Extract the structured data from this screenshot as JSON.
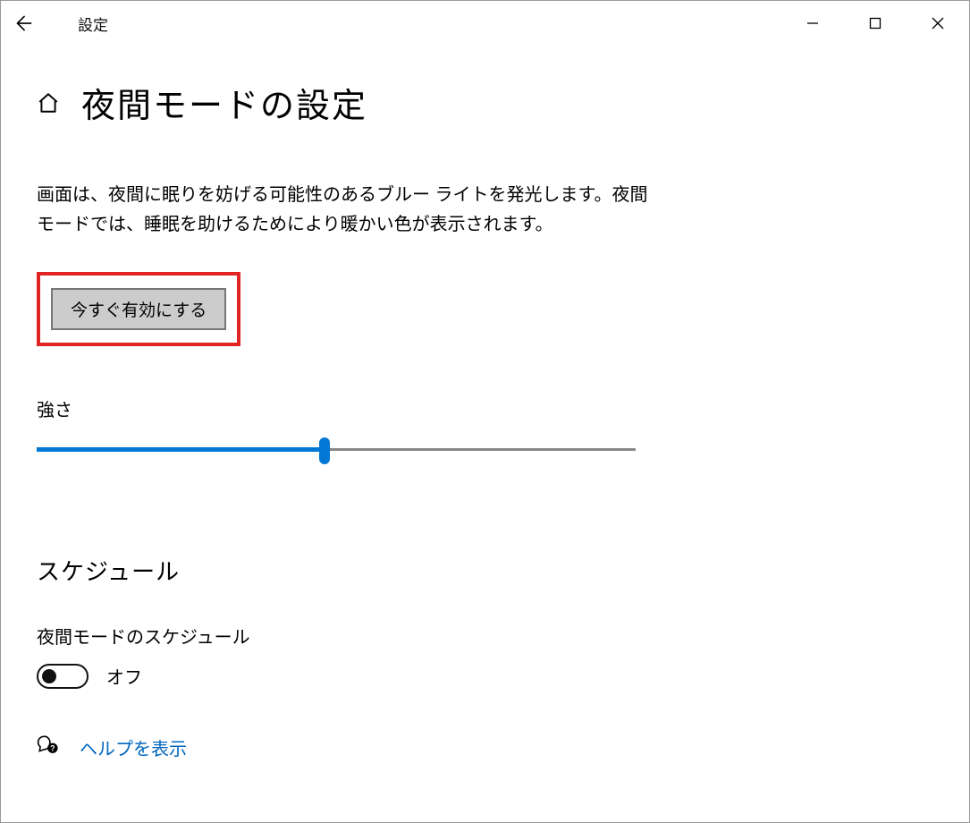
{
  "window": {
    "app_title": "設定"
  },
  "page": {
    "title": "夜間モードの設定",
    "description": "画面は、夜間に眠りを妨げる可能性のあるブルー ライトを発光します。夜間モードでは、睡眠を助けるためにより暖かい色が表示されます。",
    "enable_now_label": "今すぐ有効にする",
    "strength_label": "強さ",
    "strength_value_percent": 48,
    "schedule_heading": "スケジュール",
    "schedule_toggle_label": "夜間モードのスケジュール",
    "schedule_toggle_state": "オフ",
    "help_link": "ヘルプを表示"
  },
  "colors": {
    "accent": "#0078D4",
    "link": "#0067C0",
    "highlight_border": "#E02424"
  }
}
